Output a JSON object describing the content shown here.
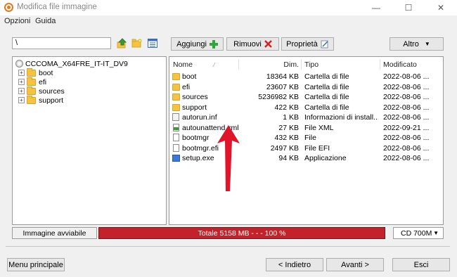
{
  "window": {
    "title": "Modifica file immagine",
    "controls": {
      "minimize": "—",
      "maximize": "☐",
      "close": "✕"
    }
  },
  "menu": [
    "Opzioni",
    "Guida"
  ],
  "toolbar": {
    "path_value": "\\",
    "add_label": "Aggiungi",
    "remove_label": "Rimuovi",
    "properties_label": "Proprietà",
    "more_label": "Altro",
    "icons": [
      "navigate-up-icon",
      "new-folder-icon",
      "view-mode-icon"
    ]
  },
  "tree": {
    "root": "CCCOMA_X64FRE_IT-IT_DV9",
    "children": [
      "boot",
      "efi",
      "sources",
      "support"
    ]
  },
  "file_list": {
    "columns": [
      "Nome",
      "Dim.",
      "Tipo",
      "Modificato"
    ],
    "sort_indicator": "⁄",
    "rows": [
      {
        "name": "boot",
        "size": "18364 KB",
        "type": "Cartella di file",
        "modified": "2022-08-06 ...",
        "icon": "folder"
      },
      {
        "name": "efi",
        "size": "23607 KB",
        "type": "Cartella di file",
        "modified": "2022-08-06 ...",
        "icon": "folder"
      },
      {
        "name": "sources",
        "size": "5236982 KB",
        "type": "Cartella di file",
        "modified": "2022-08-06 ...",
        "icon": "folder"
      },
      {
        "name": "support",
        "size": "422 KB",
        "type": "Cartella di file",
        "modified": "2022-08-06 ...",
        "icon": "folder"
      },
      {
        "name": "autorun.inf",
        "size": "1 KB",
        "type": "Informazioni di install...",
        "modified": "2022-08-06 ...",
        "icon": "inf"
      },
      {
        "name": "autounattend.xml",
        "size": "27 KB",
        "type": "File XML",
        "modified": "2022-09-21 ...",
        "icon": "xml"
      },
      {
        "name": "bootmgr",
        "size": "432 KB",
        "type": "File",
        "modified": "2022-08-06 ...",
        "icon": "file"
      },
      {
        "name": "bootmgr.efi",
        "size": "2497 KB",
        "type": "File EFI",
        "modified": "2022-08-06 ...",
        "icon": "file"
      },
      {
        "name": "setup.exe",
        "size": "94 KB",
        "type": "Applicazione",
        "modified": "2022-08-06 ...",
        "icon": "exe"
      }
    ]
  },
  "status": {
    "bootable_label": "Immagine avviabile",
    "progress_text": "Totale 5158 MB  - - -  100 %",
    "progress_fraction": 1.0,
    "media_selected": "CD 700M"
  },
  "footer": {
    "main_menu_label": "Menu principale",
    "back_label": "< Indietro",
    "next_label": "Avanti >",
    "exit_label": "Esci"
  },
  "colors": {
    "progress": "#c4222a",
    "arrow": "#e0152a"
  }
}
